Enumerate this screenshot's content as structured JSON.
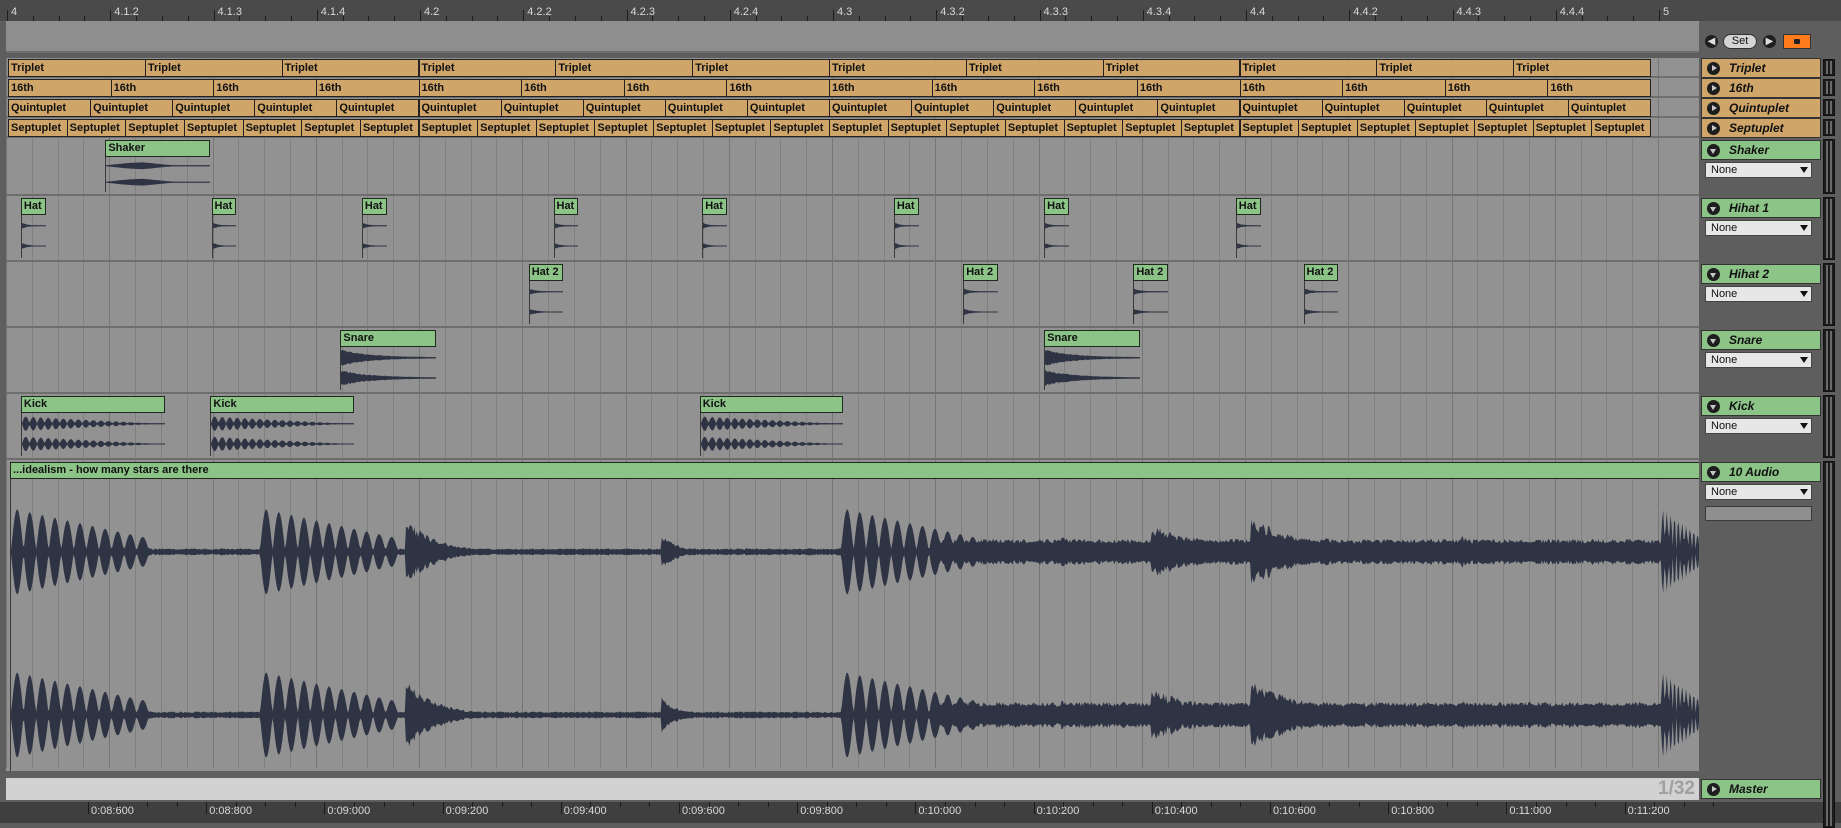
{
  "top_ruler": {
    "labels": [
      "4",
      "4.1.2",
      "4.1.3",
      "4.1.4",
      "4.2",
      "4.2.2",
      "4.2.3",
      "4.2.4",
      "4.3",
      "4.3.2",
      "4.3.3",
      "4.3.4",
      "4.4",
      "4.4.2",
      "4.4.3",
      "4.4.4",
      "5"
    ]
  },
  "set_controls": {
    "prev_label": "◀",
    "set_label": "Set",
    "next_label": "▶"
  },
  "tracks": [
    {
      "id": "triplet",
      "name": "Triplet",
      "color": "#cfa569",
      "type": "grid",
      "clip_name": "Triplet",
      "divisions": 12
    },
    {
      "id": "sixteenth",
      "name": "16th",
      "color": "#cfa569",
      "type": "grid",
      "clip_name": "16th",
      "divisions": 16
    },
    {
      "id": "quintuplet",
      "name": "Quintuplet",
      "color": "#cfa569",
      "type": "grid",
      "clip_name": "Quintuplet",
      "divisions": 20
    },
    {
      "id": "septuplet",
      "name": "Septuplet",
      "color": "#cfa569",
      "type": "grid",
      "clip_name": "Septuplet",
      "divisions": 28
    },
    {
      "id": "shaker",
      "name": "Shaker",
      "color": "#8cc387",
      "type": "audio",
      "input": "None",
      "clip_name": "Shaker",
      "clip_count": 1
    },
    {
      "id": "hihat1",
      "name": "Hihat 1",
      "color": "#8cc387",
      "type": "audio",
      "input": "None",
      "clip_name": "Hat 1",
      "clip_count": 8
    },
    {
      "id": "hihat2",
      "name": "Hihat 2",
      "color": "#8cc387",
      "type": "audio",
      "input": "None",
      "clip_name": "Hat 2",
      "clip_count": 4
    },
    {
      "id": "snare",
      "name": "Snare",
      "color": "#8cc387",
      "type": "audio",
      "input": "None",
      "clip_name": "Snare",
      "clip_count": 2
    },
    {
      "id": "kick",
      "name": "Kick",
      "color": "#8cc387",
      "type": "audio",
      "input": "None",
      "clip_name": "Kick",
      "clip_count": 3
    },
    {
      "id": "audio10",
      "name": "10 Audio",
      "color": "#8cc387",
      "type": "audio",
      "input": "None",
      "clip_name": "...idealism - how many stars are there",
      "clip_count": 1
    }
  ],
  "master": {
    "name": "Master"
  },
  "zoom": "1/32",
  "time_ruler": {
    "labels": [
      "0:08:600",
      "0:08:800",
      "0:09:000",
      "0:09:200",
      "0:09:400",
      "0:09:600",
      "0:09:800",
      "0:10:000",
      "0:10:200",
      "0:10:400",
      "0:10:600",
      "0:10:800",
      "0:11:000",
      "0:11:200"
    ]
  },
  "colors": {
    "clip_orange": "#cfa569",
    "clip_green": "#8cc387",
    "waveform": "#2e3444",
    "lock_orange": "#ff7b1c"
  }
}
